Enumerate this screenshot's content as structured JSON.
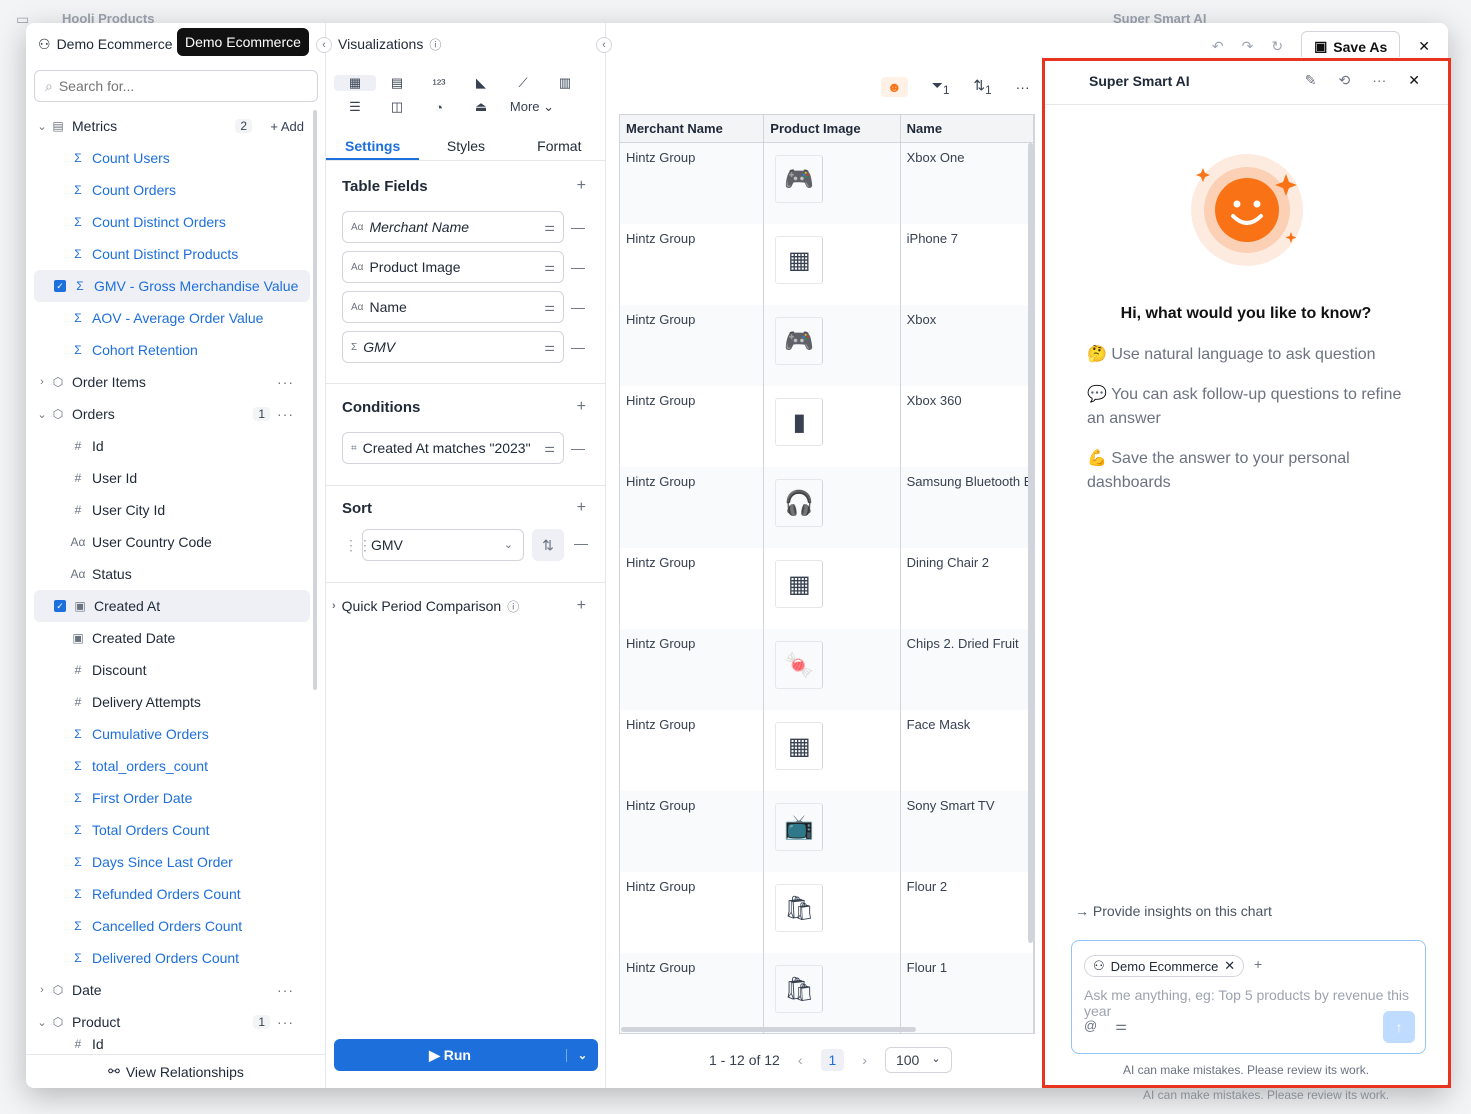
{
  "background": {
    "title": "Hooli Products",
    "ai_title": "Super Smart AI",
    "disclaimer": "AI can make mistakes. Please review its work.",
    "zoom": "82%"
  },
  "left": {
    "dataset": "Demo Ecommerce",
    "tooltip": "Demo Ecommerce",
    "search_placeholder": "Search for...",
    "metrics": {
      "label": "Metrics",
      "count": "2",
      "add_label": "Add",
      "items": [
        "Count Users",
        "Count Orders",
        "Count Distinct Orders",
        "Count Distinct Products",
        "GMV - Gross Merchandise Value",
        "AOV - Average Order Value",
        "Cohort Retention"
      ]
    },
    "order_items": "Order Items",
    "orders": {
      "label": "Orders",
      "count": "1",
      "items": [
        {
          "icon": "#",
          "label": "Id"
        },
        {
          "icon": "#",
          "label": "User Id"
        },
        {
          "icon": "#",
          "label": "User City Id"
        },
        {
          "icon": "Aα",
          "label": "User Country Code"
        },
        {
          "icon": "Aα",
          "label": "Status"
        },
        {
          "icon": "cal",
          "label": "Created At"
        },
        {
          "icon": "cal",
          "label": "Created Date"
        },
        {
          "icon": "#",
          "label": "Discount"
        },
        {
          "icon": "#",
          "label": "Delivery Attempts"
        }
      ],
      "metrics": [
        "Cumulative Orders",
        "total_orders_count",
        "First Order Date",
        "Total Orders Count",
        "Days Since Last Order",
        "Refunded Orders Count",
        "Cancelled Orders Count",
        "Delivered Orders Count"
      ]
    },
    "date": "Date",
    "product": {
      "label": "Product",
      "count": "1",
      "first_item": "Id"
    },
    "footer": "View Relationships"
  },
  "mid": {
    "title": "Visualizations",
    "more": "More",
    "tabs": [
      "Settings",
      "Styles",
      "Format"
    ],
    "table_fields_title": "Table Fields",
    "fields": [
      {
        "type": "Aα",
        "label": "Merchant Name",
        "italic": true
      },
      {
        "type": "Aα",
        "label": "Product Image",
        "italic": false
      },
      {
        "type": "Aα",
        "label": "Name",
        "italic": false
      },
      {
        "type": "Σ",
        "label": "GMV",
        "italic": true
      }
    ],
    "conditions_title": "Conditions",
    "condition": "Created At matches \"2023\"",
    "sort_title": "Sort",
    "sort_field": "GMV",
    "qpc": "Quick Period Comparison",
    "run": "Run"
  },
  "right": {
    "save_as": "Save As",
    "filter_count": "1",
    "sort_count": "1",
    "columns": [
      "Merchant Name",
      "Product Image",
      "Name"
    ],
    "rows": [
      {
        "merchant": "Hintz Group",
        "img": "🎮",
        "name": "Xbox One"
      },
      {
        "merchant": "Hintz Group",
        "img": "▦",
        "name": "iPhone 7"
      },
      {
        "merchant": "Hintz Group",
        "img": "🎮",
        "name": "Xbox"
      },
      {
        "merchant": "Hintz Group",
        "img": "▮",
        "name": "Xbox 360"
      },
      {
        "merchant": "Hintz Group",
        "img": "🎧",
        "name": "Samsung Bluetooth E"
      },
      {
        "merchant": "Hintz Group",
        "img": "▦",
        "name": "Dining Chair 2"
      },
      {
        "merchant": "Hintz Group",
        "img": "🍬",
        "name": "Chips 2. Dried Fruit"
      },
      {
        "merchant": "Hintz Group",
        "img": "▦",
        "name": "Face Mask"
      },
      {
        "merchant": "Hintz Group",
        "img": "📺",
        "name": "Sony Smart TV"
      },
      {
        "merchant": "Hintz Group",
        "img": "🛍",
        "name": "Flour 2"
      },
      {
        "merchant": "Hintz Group",
        "img": "🛍",
        "name": "Flour 1"
      }
    ],
    "pagination": {
      "range": "1 - 12 of 12",
      "page": "1",
      "page_size": "100"
    }
  },
  "ai": {
    "title": "Super Smart AI",
    "greeting": "Hi, what would you like to know?",
    "tips": [
      "🤔 Use natural language to ask question",
      "💬 You can ask follow-up questions to refine an answer",
      "💪 Save the answer to your personal dashboards"
    ],
    "suggestion": "Provide insights on this chart",
    "chip": "Demo Ecommerce",
    "placeholder": "Ask me anything, eg: Top 5 products by revenue this year",
    "disclaimer": "AI can make mistakes. Please review its work.",
    "accent": "#f97316",
    "highlight": "#e8331e"
  }
}
